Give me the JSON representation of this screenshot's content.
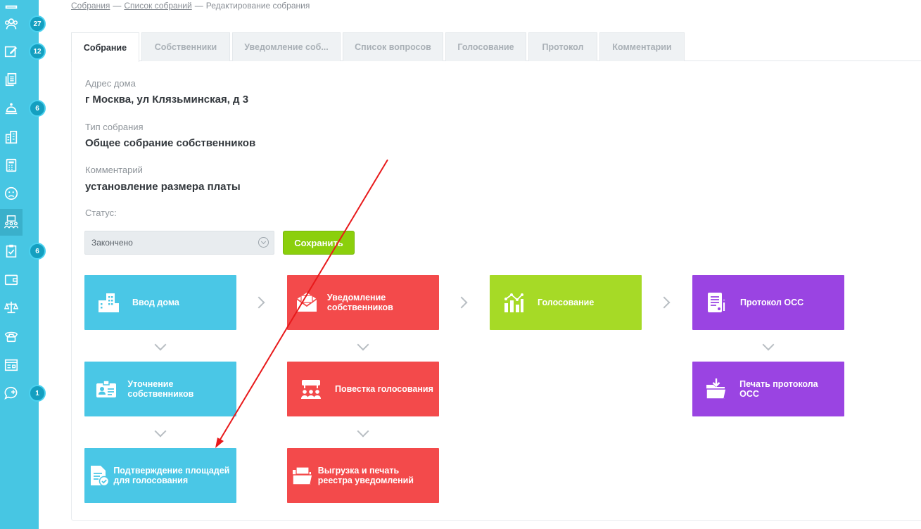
{
  "sidebar": {
    "badges": [
      "27",
      "12",
      "6",
      "6",
      "1"
    ]
  },
  "breadcrumb": {
    "items": [
      "Собрания",
      "Список собраний",
      "Редактирование собрания"
    ],
    "separator": "—"
  },
  "tabs": [
    "Собрание",
    "Собственники",
    "Уведомление соб...",
    "Список вопросов",
    "Голосование",
    "Протокол",
    "Комментарии"
  ],
  "form": {
    "address_label": "Адрес дома",
    "address_value": "г Москва, ул Клязьминская, д 3",
    "type_label": "Тип собрания",
    "type_value": "Общее собрание собственников",
    "comment_label": "Комментарий",
    "comment_value": "установление размера платы",
    "status_label": "Статус:",
    "status_value": "Закончено",
    "save_label": "Сохранить"
  },
  "steps": {
    "home_input": "Ввод дома",
    "owners_refine": "Уточнение собственников",
    "area_confirm": "Подтверждение площадей для голосования",
    "owners_notice": "Уведомление собственников",
    "agenda": "Повестка голосования",
    "registry_export": "Выгрузка и печать реестра уведомлений",
    "voting": "Голосование",
    "protocol": "Протокол ОСС",
    "protocol_print": "Печать протокола ОСС"
  },
  "colors": {
    "sidebar": "#47c6e3",
    "blue": "#4ac7e6",
    "red": "#f34a4b",
    "green": "#a6da26",
    "purple": "#9a44e2",
    "save": "#8bcf0c",
    "annotation_arrow": "#e8191b"
  }
}
